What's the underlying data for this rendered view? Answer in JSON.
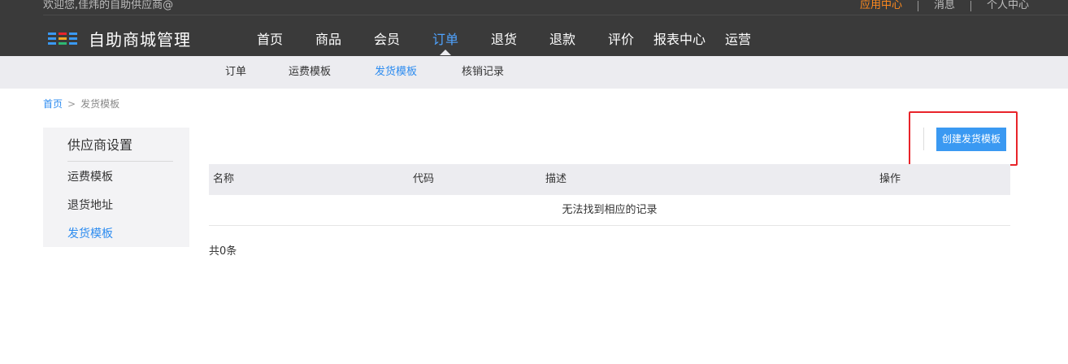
{
  "header": {
    "welcome": "欢迎您,佳炜的自助供应商@",
    "links": [
      "应用中心",
      "消息",
      "个人中心"
    ],
    "app_title": "自助商城管理",
    "logo_colors": [
      "#3a99f2",
      "#e8242a",
      "#3a99f2",
      "#3a99f2",
      "#f5a623",
      "#3a99f2",
      "#3a99f2",
      "#2eb872",
      "#3a99f2"
    ]
  },
  "main_nav": [
    "首页",
    "商品",
    "会员",
    "订单",
    "退货",
    "退款",
    "评价",
    "报表中心",
    "运营"
  ],
  "main_nav_active": "订单",
  "sub_nav": [
    "订单",
    "运费模板",
    "发货模板",
    "核销记录"
  ],
  "sub_nav_active": "发货模板",
  "breadcrumb": {
    "home": "首页",
    "separator": ">",
    "current": "发货模板"
  },
  "sidebar": {
    "title": "供应商设置",
    "items": [
      "运费模板",
      "退货地址",
      "发货模板"
    ],
    "active": "发货模板"
  },
  "toolbar": {
    "create_label": "创建发货模板"
  },
  "table": {
    "columns": [
      "名称",
      "代码",
      "描述",
      "操作"
    ],
    "empty_text": "无法找到相应的记录"
  },
  "footer": {
    "total": "共0条"
  },
  "colors": {
    "accent": "#2d8cf0",
    "topbar": "#3a3a3a",
    "highlight": "#e8242a",
    "button": "#3a99f2"
  }
}
